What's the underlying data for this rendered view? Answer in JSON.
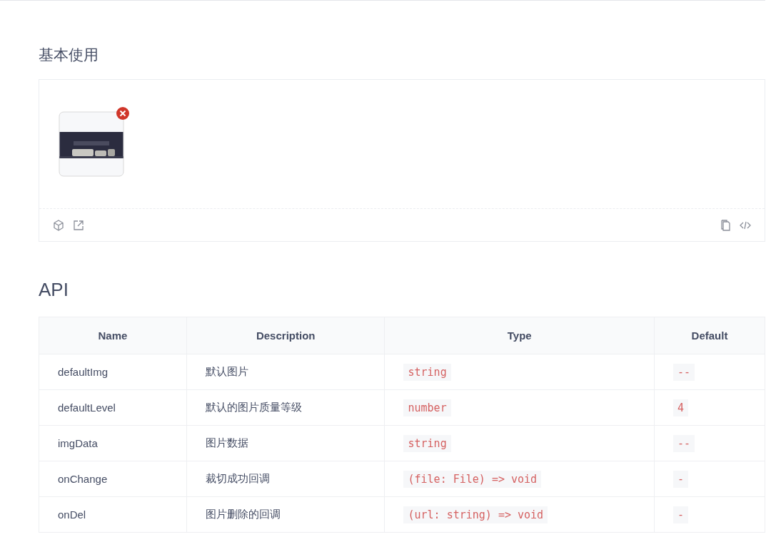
{
  "demo": {
    "title": "基本使用",
    "upload": {
      "kind": "picture",
      "removable": true
    }
  },
  "api": {
    "title": "API",
    "table": {
      "columns": [
        "Name",
        "Description",
        "Type",
        "Default"
      ],
      "rows": [
        {
          "name": "defaultImg",
          "description": "默认图片",
          "type": "string",
          "default": "--"
        },
        {
          "name": "defaultLevel",
          "description": "默认的图片质量等级",
          "type": "number",
          "default": "4"
        },
        {
          "name": "imgData",
          "description": "图片数据",
          "type": "string",
          "default": "--"
        },
        {
          "name": "onChange",
          "description": "裁切成功回调",
          "type": "(file: File) => void",
          "default": "-"
        },
        {
          "name": "onDel",
          "description": "图片删除的回调",
          "type": "(url: string) => void",
          "default": "-"
        }
      ]
    }
  }
}
